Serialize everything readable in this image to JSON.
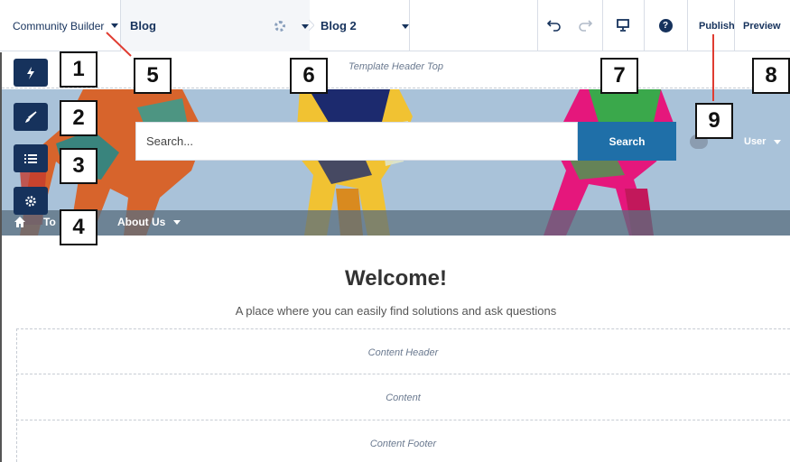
{
  "toolbar": {
    "app_menu_label": "Community Builder",
    "page_name": "Blog",
    "page_variation": "Blog 2",
    "publish_label": "Publish",
    "preview_label": "Preview",
    "icons": [
      "undo-icon",
      "redo-icon",
      "device-preview-icon",
      "help-icon",
      "page-settings-icon"
    ]
  },
  "side_panel": {
    "buttons": [
      "components-icon",
      "theme-brush-icon",
      "page-structure-icon",
      "settings-icon"
    ]
  },
  "canvas": {
    "template_header_top": "Template Header Top",
    "search_placeholder": "Search...",
    "search_button": "Search",
    "user_label": "User",
    "nav_items": [
      "To",
      "About Us"
    ],
    "welcome_title": "Welcome!",
    "tagline": "A place where you can easily find solutions and ask questions",
    "regions": [
      "Content Header",
      "Content",
      "Content Footer"
    ]
  },
  "callouts": [
    "1",
    "2",
    "3",
    "4",
    "5",
    "6",
    "7",
    "8",
    "9"
  ],
  "colors": {
    "navy": "#16325c",
    "search_button": "#1f6fa8",
    "hero_background": "#a9c2d9"
  }
}
